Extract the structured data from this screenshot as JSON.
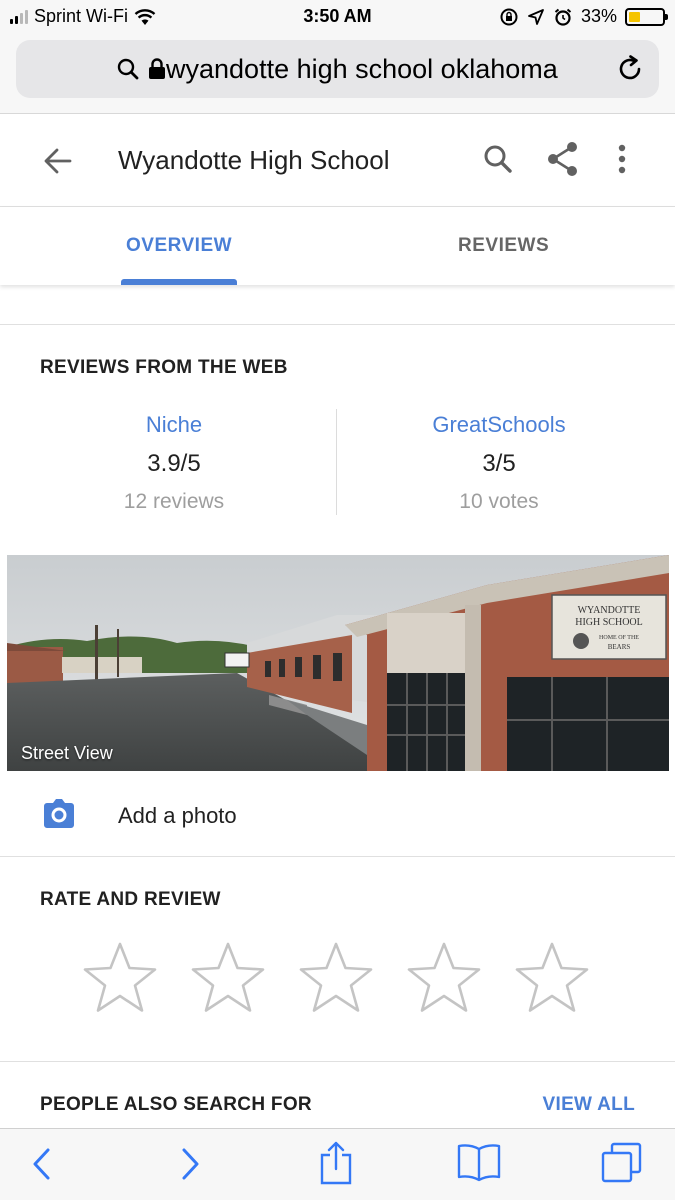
{
  "status_bar": {
    "carrier": "Sprint Wi-Fi",
    "time": "3:50 AM",
    "battery_percent": "33%",
    "battery_level": 0.33,
    "icons": [
      "signal-icon",
      "wifi-icon",
      "screen-lock-icon",
      "location-icon",
      "alarm-icon",
      "battery-icon"
    ]
  },
  "browser": {
    "url_text": "wyandotte high school oklahoma",
    "icons": [
      "search-icon",
      "lock-icon",
      "refresh-icon"
    ]
  },
  "header": {
    "title": "Wyandotte High School",
    "icons": [
      "back-arrow-icon",
      "search-icon",
      "share-icon",
      "more-vert-icon"
    ]
  },
  "tabs": [
    {
      "label": "OVERVIEW",
      "active": true
    },
    {
      "label": "REVIEWS",
      "active": false
    }
  ],
  "reviews_from_web": {
    "heading": "REVIEWS FROM THE WEB",
    "sources": [
      {
        "name": "Niche",
        "score": "3.9/5",
        "count": "12 reviews"
      },
      {
        "name": "GreatSchools",
        "score": "3/5",
        "count": "10 votes"
      }
    ]
  },
  "street_view": {
    "label": "Street View",
    "sign_text": [
      "WYANDOTTE",
      "HIGH SCHOOL",
      "HOME OF THE",
      "BEARS"
    ]
  },
  "add_photo": {
    "label": "Add a photo",
    "icon": "camera-icon"
  },
  "rate_review": {
    "heading": "RATE AND REVIEW",
    "star_count": 5,
    "icon": "star-outline-icon"
  },
  "people_also_search": {
    "heading": "PEOPLE ALSO SEARCH FOR",
    "view_all": "VIEW ALL"
  },
  "toolbar": {
    "icons": [
      "back-icon",
      "forward-icon",
      "share-icon",
      "bookmarks-icon",
      "tabs-icon"
    ]
  },
  "colors": {
    "accent": "#4a7fd6",
    "text": "#212121",
    "muted": "#9e9e9e"
  }
}
